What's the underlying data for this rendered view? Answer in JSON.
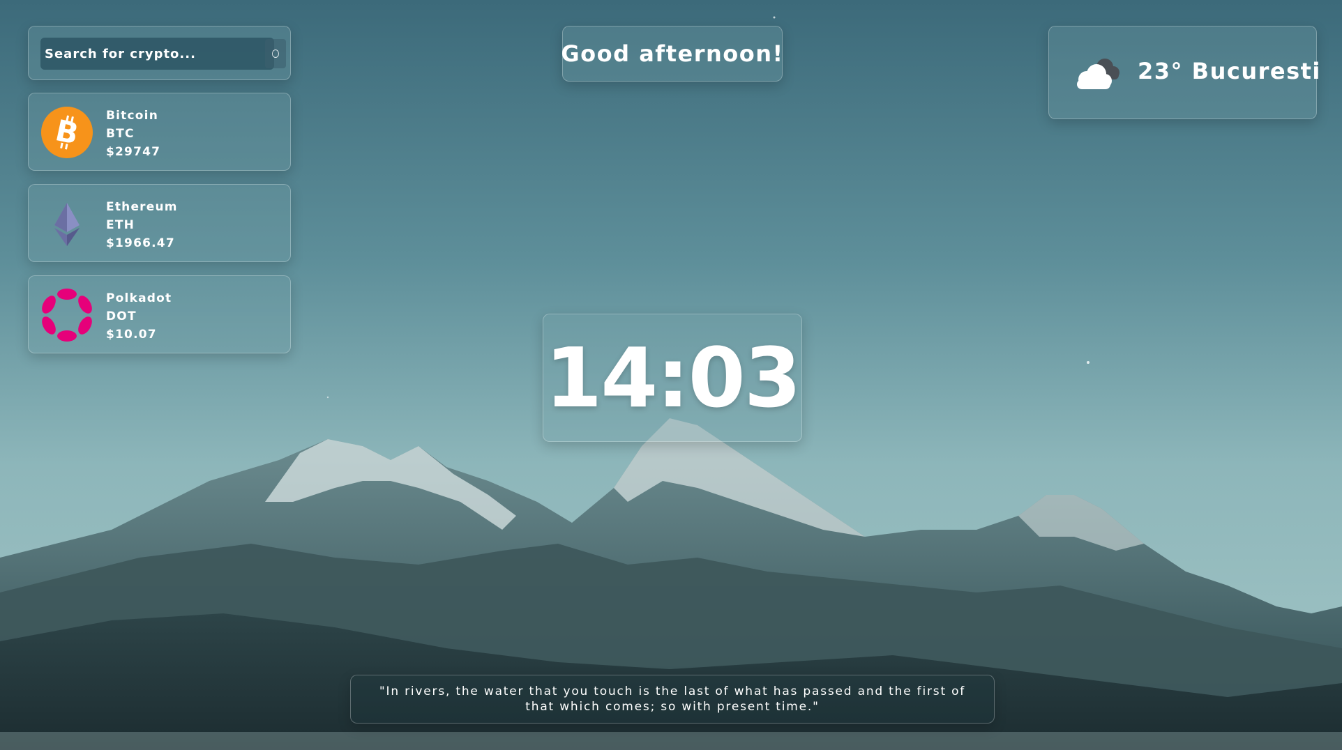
{
  "search": {
    "placeholder": "Search for crypto..."
  },
  "coins": [
    {
      "name": "Bitcoin",
      "symbol": "BTC",
      "price": "$29747",
      "icon": "bitcoin-icon",
      "color": "#f7931a"
    },
    {
      "name": "Ethereum",
      "symbol": "ETH",
      "price": "$1966.47",
      "icon": "ethereum-icon",
      "color": "#6b6fa3"
    },
    {
      "name": "Polkadot",
      "symbol": "DOT",
      "price": "$10.07",
      "icon": "polkadot-icon",
      "color": "#e6007a"
    }
  ],
  "greeting": "Good afternoon!",
  "weather": {
    "text": "23° Bucuresti",
    "icon": "cloud-icon"
  },
  "clock": "14:03",
  "quote": "\"In rivers, the water that you touch is the last of what has passed and the first of that which comes; so with present time.\""
}
